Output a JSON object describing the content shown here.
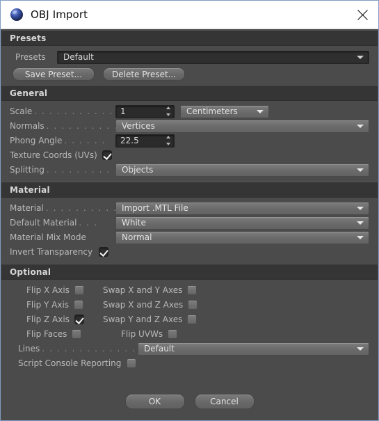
{
  "window": {
    "title": "OBJ Import",
    "app_icon": "sphere-icon",
    "close_icon": "close-icon",
    "accent_border": "#7f9dc4",
    "panel_bg": "#4b4b4b",
    "header_bg": "#353535"
  },
  "groups": {
    "presets": {
      "header": "Presets",
      "preset_label": "Presets",
      "preset_value": "Default",
      "save_label": "Save Preset...",
      "delete_label": "Delete Preset..."
    },
    "general": {
      "header": "General",
      "rows": [
        {
          "label": "Scale",
          "dots": ". . . . . . . . . . . .",
          "value": "1",
          "unit": "Centimeters"
        },
        {
          "label": "Normals",
          "dots": ". . . . . . . . . .",
          "value": "Vertices"
        },
        {
          "label": "Phong Angle",
          "dots": ". . . . . .",
          "value": "22.5"
        },
        {
          "label": "Texture Coords (UVs)",
          "dots": "",
          "checked": true
        },
        {
          "label": "Splitting",
          "dots": ". . . . . . . . . .",
          "value": "Objects"
        }
      ]
    },
    "material": {
      "header": "Material",
      "rows": [
        {
          "label": "Material",
          "dots": ". . . . . . . . . .",
          "value": "Import .MTL File"
        },
        {
          "label": "Default Material",
          "dots": ". . .",
          "value": "White"
        },
        {
          "label": "Material Mix Mode",
          "dots": "",
          "value": "Normal"
        },
        {
          "label": "Invert Transparency",
          "dots": "",
          "checked": true
        }
      ]
    },
    "optional": {
      "header": "Optional",
      "checkbox_rows": [
        {
          "left_label": "Flip X Axis",
          "left_checked": false,
          "right_label": "Swap X and Y Axes",
          "right_checked": false
        },
        {
          "left_label": "Flip Y Axis",
          "left_checked": false,
          "right_label": "Swap X and Z Axes",
          "right_checked": false
        },
        {
          "left_label": "Flip Z Axis",
          "left_checked": true,
          "right_label": "Swap Y and Z Axes",
          "right_checked": false
        },
        {
          "left_label": "Flip Faces",
          "left_checked": false,
          "right_label": "Flip UVWs",
          "right_checked": false
        }
      ],
      "lines_label": "Lines",
      "lines_dots": ". . . . . . . . . . . . . . .",
      "lines_value": "Default",
      "script_label": "Script Console Reporting",
      "script_checked": false
    }
  },
  "footer": {
    "ok_label": "OK",
    "cancel_label": "Cancel"
  }
}
